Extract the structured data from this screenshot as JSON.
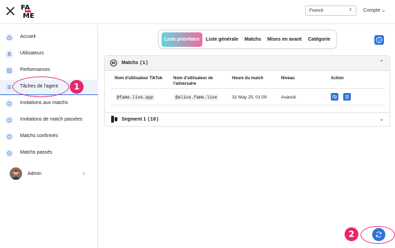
{
  "header": {
    "language": "French",
    "account_label": "Compte"
  },
  "sidebar": {
    "items": [
      {
        "label": "Accueil"
      },
      {
        "label": "Utilisateurs"
      },
      {
        "label": "Performances"
      },
      {
        "label": "Tâches de l'agent"
      },
      {
        "label": "Invitations aux matchs"
      },
      {
        "label": "Invitations de match passées"
      },
      {
        "label": "Matchs confirmés"
      },
      {
        "label": "Matchs passés"
      }
    ],
    "active_index": 3,
    "user": {
      "name": "Admin"
    }
  },
  "tabs": [
    {
      "label": "Liste prioritaire",
      "active": true
    },
    {
      "label": "Liste générale",
      "active": false
    },
    {
      "label": "Matchs",
      "active": false
    },
    {
      "label": "Mises en avant",
      "active": false
    },
    {
      "label": "Catégorie",
      "active": false
    }
  ],
  "matches": {
    "title": "Matchs",
    "count": "(1)",
    "columns": [
      "Nom d'utilisateur TikTok",
      "Nom d'utilisateur de l'adversaire",
      "Heure du match",
      "Niveau",
      "Action"
    ],
    "rows": [
      {
        "tiktok": "@fame.live.app",
        "opponent": "@alice.fame.live",
        "time": "31 May 25, 01:00",
        "level": "Avancé"
      }
    ]
  },
  "segment": {
    "title": "Segment 1",
    "count": "(10)"
  },
  "annotations": {
    "step1": "1",
    "step2": "2"
  },
  "colors": {
    "accent": "#2f72d9",
    "annotation": "#e6286a"
  }
}
